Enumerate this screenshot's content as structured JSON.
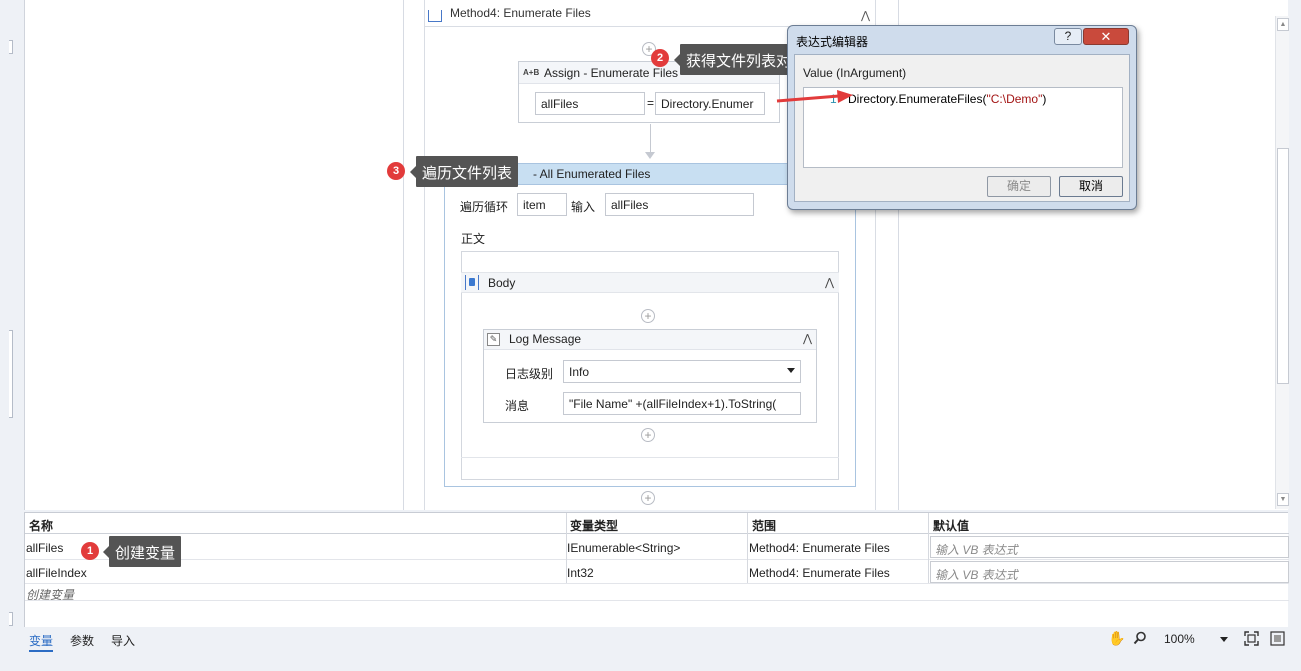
{
  "designer": {
    "method": {
      "title": "Method4: Enumerate Files"
    },
    "assign": {
      "icon_text": "A+B",
      "title": "Assign - Enumerate Files",
      "to_value": "allFiles",
      "equals": "=",
      "expr_value": "Directory.Enumer"
    },
    "foreach": {
      "title": "- All Enumerated Files",
      "loop_label": "遍历循环",
      "item_value": "item",
      "input_label": "输入",
      "input_value": "allFiles",
      "body_label": "正文"
    },
    "body": {
      "title": "Body"
    },
    "log": {
      "title": "Log Message",
      "level_label": "日志级别",
      "level_value": "Info",
      "message_label": "消息",
      "message_value": "\"File Name\" +(allFileIndex+1).ToString("
    }
  },
  "callouts": [
    {
      "num": "1",
      "text": "创建变量"
    },
    {
      "num": "2",
      "text": "获得文件列表对象"
    },
    {
      "num": "3",
      "text": "遍历文件列表"
    }
  ],
  "dialog": {
    "title": "表达式编辑器",
    "help": "?",
    "close": "✕",
    "value_label": "Value (InArgument)",
    "line_number": "1",
    "code_prefix": "Directory.EnumerateFiles(",
    "code_string": "\"C:\\Demo\"",
    "code_suffix": ")",
    "ok": "确定",
    "cancel": "取消"
  },
  "variables": {
    "headers": [
      "名称",
      "变量类型",
      "范围",
      "默认值"
    ],
    "rows": [
      {
        "name": "allFiles",
        "type": "IEnumerable<String>",
        "scope": "Method4: Enumerate Files",
        "default_placeholder": "输入 VB 表达式"
      },
      {
        "name": "allFileIndex",
        "type": "Int32",
        "scope": "Method4: Enumerate Files",
        "default_placeholder": "输入 VB 表达式"
      }
    ],
    "create_label": "创建变量"
  },
  "statusbar": {
    "tabs": [
      "变量",
      "参数",
      "导入"
    ],
    "zoom": "100%"
  },
  "colors": {
    "badge": "#e23b3b",
    "callout": "#545454",
    "foreach_header": "#c8dff2",
    "active_tab": "#2b6cc4"
  }
}
